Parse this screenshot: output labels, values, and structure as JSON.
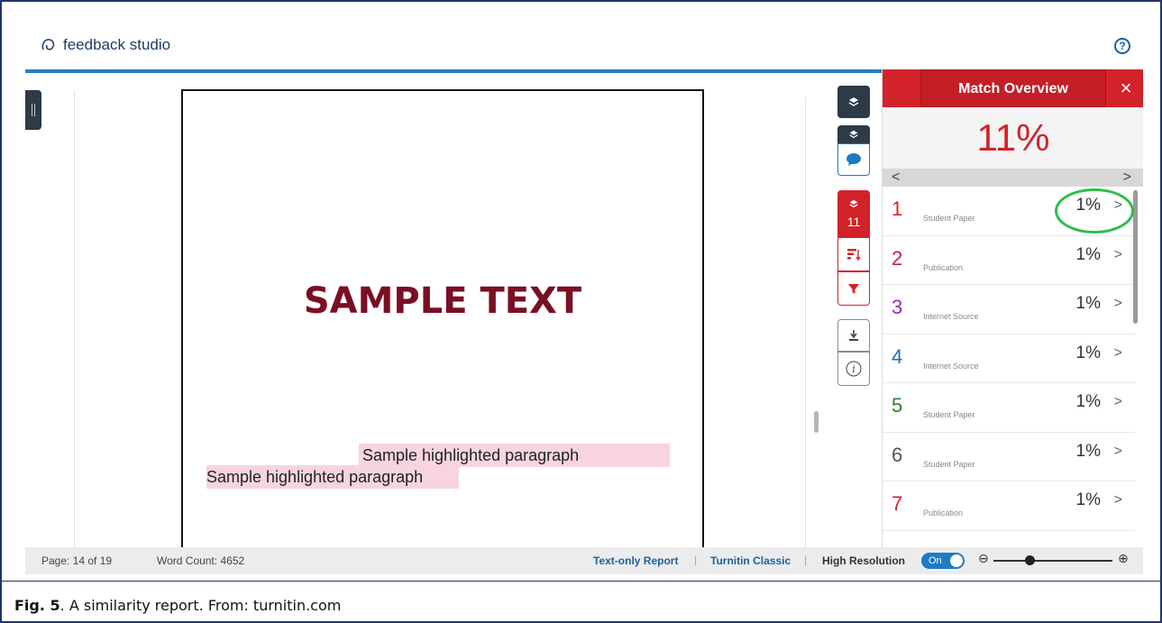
{
  "app": {
    "title": "feedback studio",
    "help_symbol": "?"
  },
  "document": {
    "title": "SAMPLE TEXT",
    "highlight_1": "Sample highlighted paragraph",
    "highlight_2": "Sample highlighted paragraph"
  },
  "toolbar": {
    "match_count": "11"
  },
  "panel": {
    "title": "Match Overview",
    "close_symbol": "×",
    "score": "11%",
    "prev_symbol": "<",
    "next_symbol": ">",
    "matches": [
      {
        "num": "1",
        "type": "Student Paper",
        "pct": "1%",
        "color": "#d2232a"
      },
      {
        "num": "2",
        "type": "Publication",
        "pct": "1%",
        "color": "#c2185b"
      },
      {
        "num": "3",
        "type": "Internet Source",
        "pct": "1%",
        "color": "#9c27b0"
      },
      {
        "num": "4",
        "type": "Internet Source",
        "pct": "1%",
        "color": "#1e6fb0"
      },
      {
        "num": "5",
        "type": "Student Paper",
        "pct": "1%",
        "color": "#2e7d32"
      },
      {
        "num": "6",
        "type": "Student Paper",
        "pct": "1%",
        "color": "#555555"
      },
      {
        "num": "7",
        "type": "Publication",
        "pct": "1%",
        "color": "#d2232a"
      }
    ]
  },
  "status": {
    "page": "Page: 14 of 19",
    "word_count": "Word Count: 4652",
    "text_only": "Text-only Report",
    "classic": "Turnitin Classic",
    "high_res": "High Resolution",
    "toggle": "On",
    "zoom_level": 0.3
  },
  "caption": {
    "fig": "Fig. 5",
    "text": ". A similarity report. From: turnitin.com"
  }
}
